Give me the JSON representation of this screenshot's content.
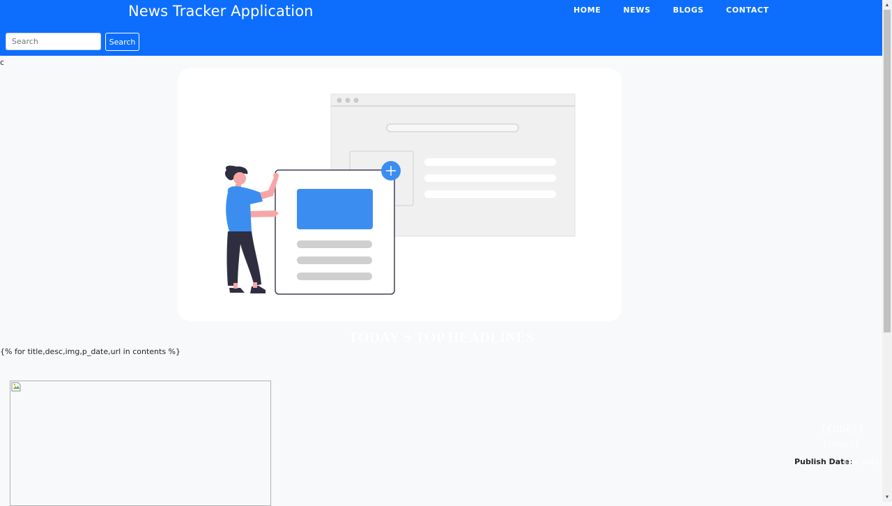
{
  "navbar": {
    "brand": "News Tracker Application",
    "links": [
      "HOME",
      "NEWS",
      "BLOGS",
      "CONTACT"
    ],
    "accent": "#0d6efd"
  },
  "search": {
    "placeholder": "Search",
    "value": "",
    "button_label": "Search"
  },
  "stray_text": "c",
  "hero": {
    "illustration": "person-adding-news-card-illustration"
  },
  "headline": "TODAY'S TOP HEADLINES",
  "loop_template": "{% for title,desc,img,p_date,url in contents %}",
  "news_item": {
    "image": "broken-image-icon",
    "title": "{{title}}",
    "desc": "{{desc}}",
    "publish_label": "Publish Date:",
    "publish_value": "{{p_date}}"
  }
}
